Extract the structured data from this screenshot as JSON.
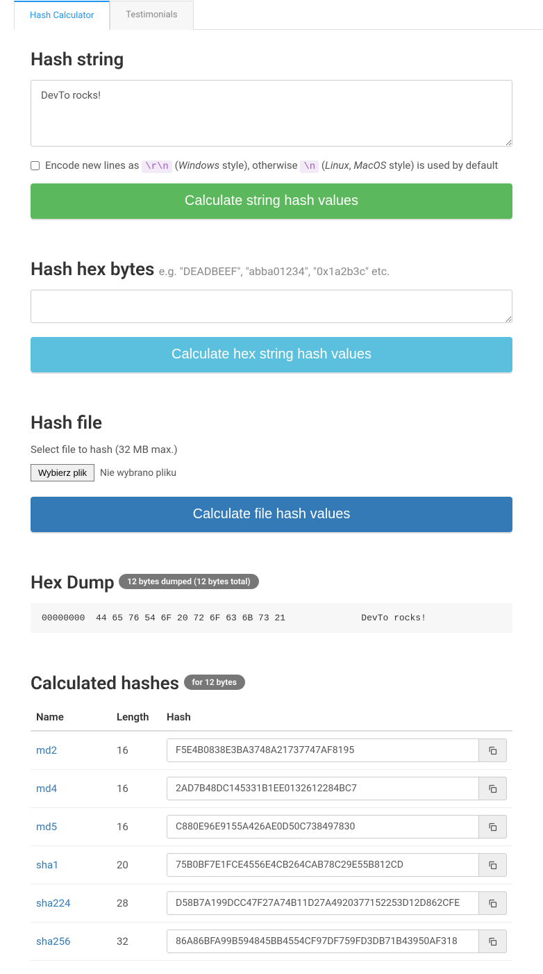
{
  "tabs": {
    "calculator": "Hash Calculator",
    "testimonials": "Testimonials"
  },
  "string_section": {
    "heading": "Hash string",
    "value": "DevTo rocks!",
    "encode_label_prefix": "Encode new lines as",
    "code_rn": "\\r\\n",
    "paren1_open": "(",
    "windows": "Windows",
    "paren1_rest": " style), otherwise",
    "code_n": "\\n",
    "paren2_open": "(",
    "linux": "Linux",
    "comma": ", ",
    "macos": "MacOS",
    "paren2_rest": " style) is used by default",
    "button": "Calculate string hash values"
  },
  "hex_section": {
    "heading": "Hash hex bytes",
    "hint": "e.g. \"DEADBEEF\", \"abba01234\", \"0x1a2b3c\" etc.",
    "value": "",
    "button": "Calculate hex string hash values"
  },
  "file_section": {
    "heading": "Hash file",
    "hint": "Select file to hash (32 MB max.)",
    "choose_btn": "Wybierz plik",
    "status": "Nie wybrano pliku",
    "button": "Calculate file hash values"
  },
  "hexdump": {
    "heading": "Hex Dump",
    "badge": "12 bytes dumped (12 bytes total)",
    "text": "00000000  44 65 76 54 6F 20 72 6F 63 6B 73 21              DevTo rocks!"
  },
  "hashes": {
    "heading": "Calculated hashes",
    "badge": "for 12 bytes",
    "cols": {
      "name": "Name",
      "length": "Length",
      "hash": "Hash"
    },
    "rows": [
      {
        "name": "md2",
        "length": "16",
        "hash": "F5E4B0838E3BA3748A21737747AF8195"
      },
      {
        "name": "md4",
        "length": "16",
        "hash": "2AD7B48DC145331B1EE0132612284BC7"
      },
      {
        "name": "md5",
        "length": "16",
        "hash": "C880E96E9155A426AE0D50C738497830"
      },
      {
        "name": "sha1",
        "length": "20",
        "hash": "75B0BF7E1FCE4556E4CB264CAB78C29E55B812CD"
      },
      {
        "name": "sha224",
        "length": "28",
        "hash": "D58B7A199DCC47F27A74B11D27A4920377152253D12D862CFE"
      },
      {
        "name": "sha256",
        "length": "32",
        "hash": "86A86BFA99B594845BB4554CF97DF759FD3DB71B43950AF318"
      }
    ]
  }
}
